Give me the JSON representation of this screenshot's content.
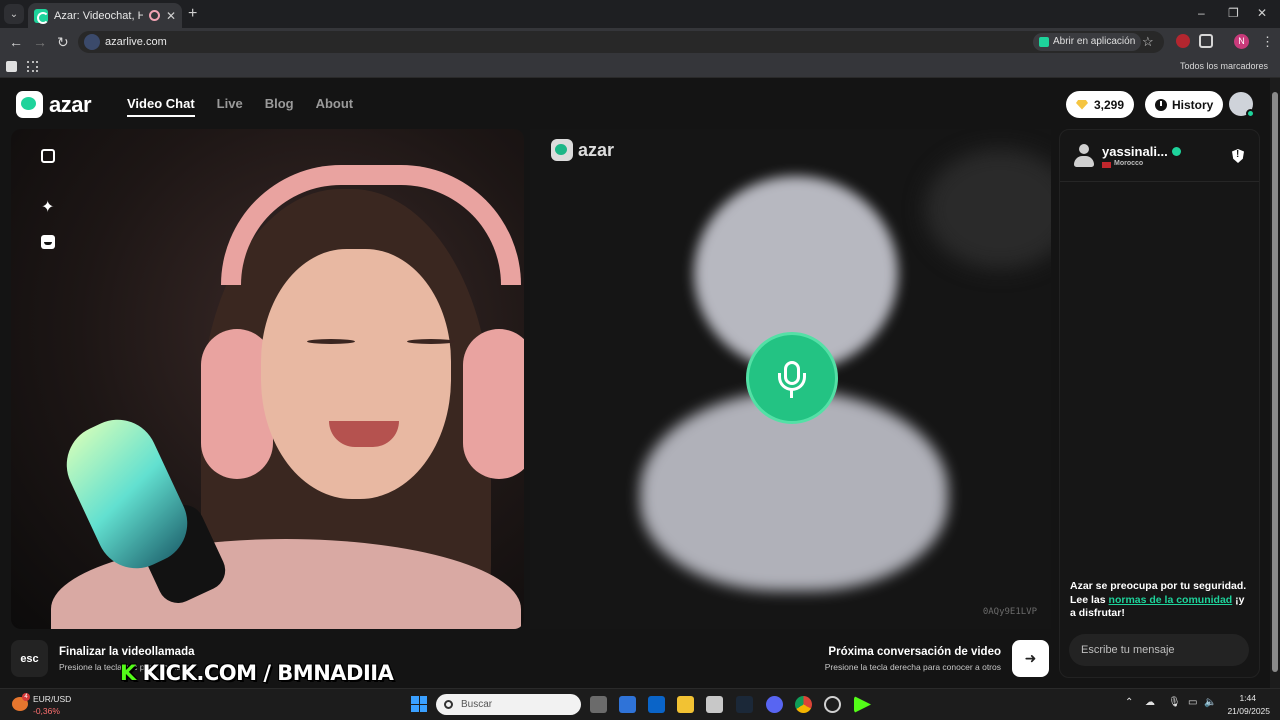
{
  "browser": {
    "tab_title": "Azar: Videochat, Haz nuevo",
    "close_tab": "✕",
    "new_tab": "+",
    "url": "azarlive.com",
    "open_in_app": "Abrir en aplicación",
    "profile_initial": "N",
    "all_bookmarks": "Todos los marcadores",
    "window_controls": [
      "–",
      "❐",
      "✕"
    ]
  },
  "header": {
    "logo_text": "azar",
    "nav": [
      "Video Chat",
      "Live",
      "Blog",
      "About"
    ],
    "active_nav": "Video Chat",
    "gems": "3,299",
    "history_label": "History"
  },
  "remote_video": {
    "watermark": "azar",
    "session_code": "0AQy9E1LVP"
  },
  "chat": {
    "username": "yassinali...",
    "country": "Morocco",
    "safety_text_1": "Azar se preocupa por tu seguridad. Lee las ",
    "safety_link": "normas de la comunidad",
    "safety_text_2": " ¡y a disfrutar!",
    "message_placeholder": "Escribe tu mensaje"
  },
  "footer": {
    "esc_key": "esc",
    "end_call_title": "Finalizar la videollamada",
    "end_call_sub": "Presione la tecla esc para finalizar",
    "next_title": "Próxima conversación de video",
    "next_sub": "Presione la tecla derecha para conocer a otros",
    "overlay_k": "K",
    "overlay_text": " KICK.COM / BMNADIIA"
  },
  "taskbar": {
    "weather_badge": "4",
    "fx_pair": "EUR/USD",
    "fx_change": "-0,36%",
    "search_placeholder": "Buscar",
    "time": "1:44",
    "date": "21/09/2025"
  },
  "colors": {
    "accent": "#1ed39b",
    "page_bg": "#141414",
    "mic_button": "#23c383"
  },
  "icons": [
    "expand-icon",
    "sparkle-icon",
    "sticker-icon",
    "microphone-icon",
    "shield-icon",
    "clock-icon",
    "gem-icon",
    "next-arrow-icon"
  ]
}
